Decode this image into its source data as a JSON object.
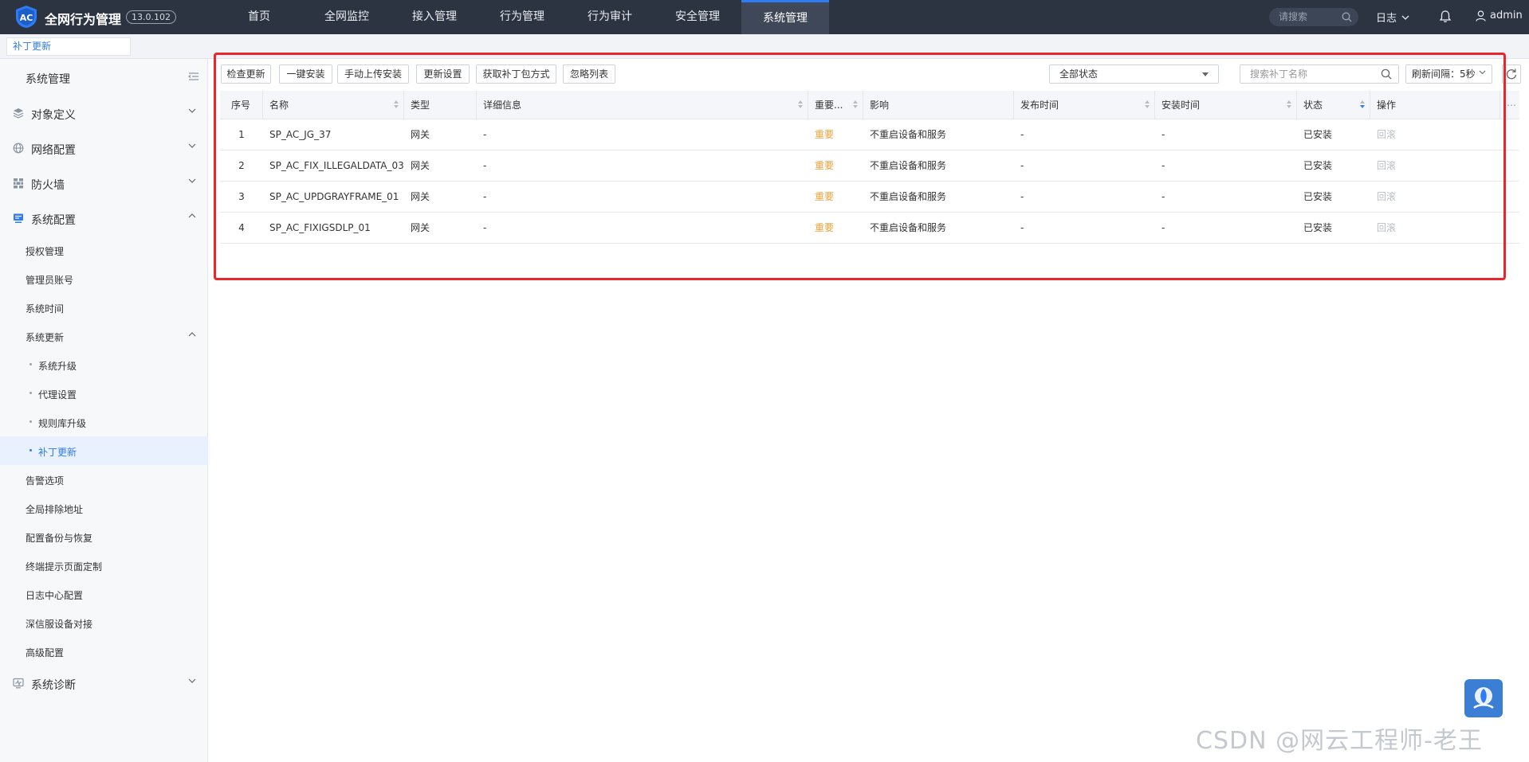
{
  "app": {
    "title": "全网行为管理",
    "version": "13.0.102"
  },
  "nav": {
    "items": [
      "首页",
      "全网监控",
      "接入管理",
      "行为管理",
      "行为审计",
      "安全管理",
      "系统管理"
    ],
    "active": "系统管理",
    "search_placeholder": "请搜索",
    "log_label": "日志",
    "user": "admin"
  },
  "page_tab": "补丁更新",
  "sidebar": {
    "header": "系统管理",
    "groups": {
      "object": "对象定义",
      "network": "网络配置",
      "firewall": "防火墙",
      "sysconfig": "系统配置",
      "diagnosis": "系统诊断"
    },
    "sysconfig_items": {
      "license": "授权管理",
      "admin_account": "管理员账号",
      "system_time": "系统时间",
      "system_update": "系统更新",
      "alarm": "告警选项",
      "exclude": "全局排除地址",
      "backup": "配置备份与恢复",
      "terminal_page": "终端提示页面定制",
      "log_center": "日志中心配置",
      "sangfor_device": "深信服设备对接",
      "advanced": "高级配置"
    },
    "update_items": {
      "upgrade": "系统升级",
      "proxy": "代理设置",
      "rule_lib": "规则库升级",
      "patch": "补丁更新"
    }
  },
  "toolbar": {
    "check_update": "检查更新",
    "one_click_install": "一键安装",
    "manual_upload": "手动上传安装",
    "update_settings": "更新设置",
    "get_patch": "获取补丁包方式",
    "ignore_list": "忽略列表",
    "status_filter": "全部状态",
    "search_placeholder": "搜索补丁名称",
    "refresh_interval": "刷新间隔：5秒"
  },
  "table": {
    "headers": {
      "seq": "序号",
      "name": "名称",
      "type": "类型",
      "detail": "详细信息",
      "importance": "重要...",
      "impact": "影响",
      "release_time": "发布时间",
      "install_time": "安装时间",
      "status": "状态",
      "action": "操作"
    },
    "rows": [
      {
        "seq": "1",
        "name": "SP_AC_JG_37",
        "type": "网关",
        "detail": "-",
        "importance": "重要",
        "impact": "不重启设备和服务",
        "release_time": "-",
        "install_time": "-",
        "status": "已安装",
        "action": "回滚"
      },
      {
        "seq": "2",
        "name": "SP_AC_FIX_ILLEGALDATA_03",
        "type": "网关",
        "detail": "-",
        "importance": "重要",
        "impact": "不重启设备和服务",
        "release_time": "-",
        "install_time": "-",
        "status": "已安装",
        "action": "回滚"
      },
      {
        "seq": "3",
        "name": "SP_AC_UPDGRAYFRAME_01",
        "type": "网关",
        "detail": "-",
        "importance": "重要",
        "impact": "不重启设备和服务",
        "release_time": "-",
        "install_time": "-",
        "status": "已安装",
        "action": "回滚"
      },
      {
        "seq": "4",
        "name": "SP_AC_FIXIGSDLP_01",
        "type": "网关",
        "detail": "-",
        "importance": "重要",
        "impact": "不重启设备和服务",
        "release_time": "-",
        "install_time": "-",
        "status": "已安装",
        "action": "回滚"
      }
    ]
  },
  "watermark": "CSDN @网云工程师-老王",
  "colors": {
    "topbar": "#2c3442",
    "accent": "#2f7bf5",
    "important": "#f0a13a",
    "highlight_box": "#e8262b"
  }
}
